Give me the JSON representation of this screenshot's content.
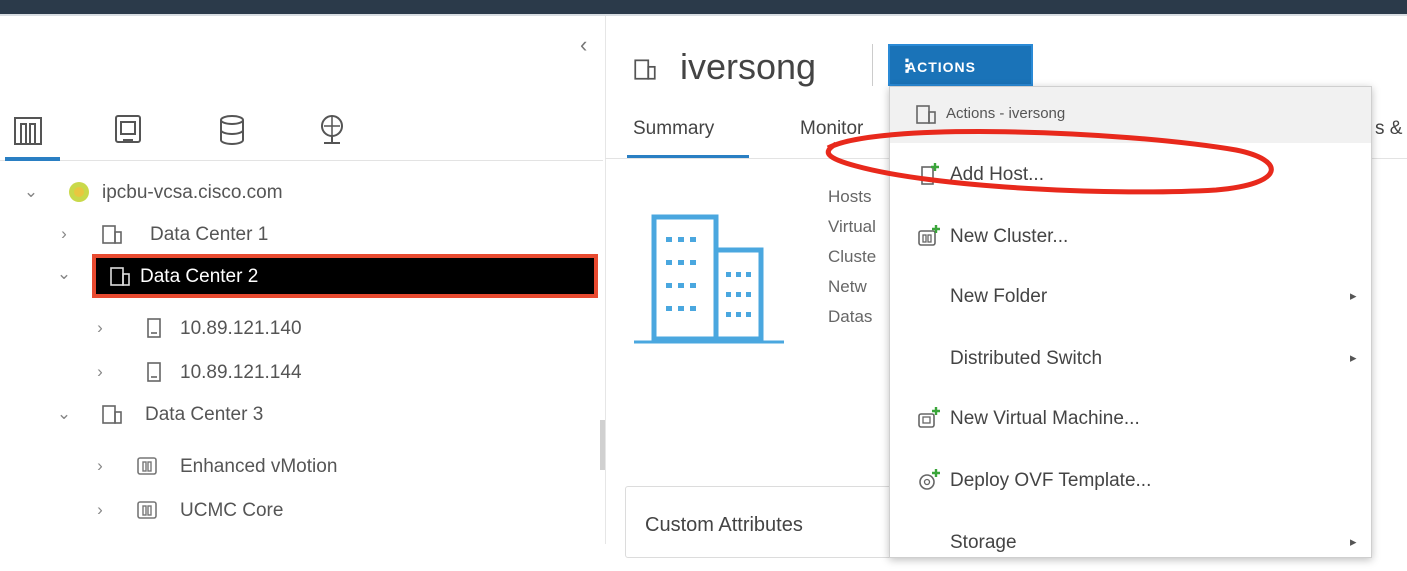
{
  "navigator": {
    "collapse_glyph": "‹",
    "tabs": [
      {
        "name": "hosts-clusters-icon"
      },
      {
        "name": "vms-templates-icon"
      },
      {
        "name": "storage-icon"
      },
      {
        "name": "networking-icon"
      }
    ],
    "tree": [
      {
        "label": "ipcbu-vcsa.cisco.com",
        "expanded": true,
        "icon": "vcenter-icon",
        "level": 0
      },
      {
        "label": "Data Center 1",
        "expanded": false,
        "icon": "datacenter-icon",
        "level": 1
      },
      {
        "label": "Data Center 2",
        "expanded": true,
        "icon": "datacenter-icon",
        "level": 1,
        "selected": true
      },
      {
        "label": "10.89.121.140",
        "expanded": false,
        "icon": "host-icon",
        "level": 2
      },
      {
        "label": "10.89.121.144",
        "expanded": false,
        "icon": "host-icon",
        "level": 2
      },
      {
        "label": "Data Center 3",
        "expanded": true,
        "icon": "datacenter-icon",
        "level": 1
      },
      {
        "label": "Enhanced vMotion",
        "expanded": false,
        "icon": "cluster-icon",
        "level": 2
      },
      {
        "label": "UCMC Core",
        "expanded": false,
        "icon": "cluster-icon",
        "level": 2
      }
    ]
  },
  "object": {
    "title": "iversong",
    "actions_label": "ACTIONS",
    "tabs": [
      {
        "label": "Summary",
        "active": true
      },
      {
        "label": "Monitor",
        "active": false
      }
    ],
    "tab_cut_right": "s &",
    "summary_labels": [
      "Hosts",
      "Virtual",
      "Cluste",
      "Netw",
      "Datas"
    ],
    "custom_attributes_title": "Custom Attributes"
  },
  "actions_menu": {
    "header": "Actions - iversong",
    "items": [
      {
        "label": "Add Host...",
        "icon": "add-host-icon",
        "submenu": false,
        "highlighted": true
      },
      {
        "label": "New Cluster...",
        "icon": "new-cluster-icon",
        "submenu": false
      },
      {
        "label": "New Folder",
        "icon": "",
        "submenu": true
      },
      {
        "label": "Distributed Switch",
        "icon": "",
        "submenu": true
      },
      {
        "label": "New Virtual Machine...",
        "icon": "new-vm-icon",
        "submenu": false
      },
      {
        "label": "Deploy OVF Template...",
        "icon": "deploy-ovf-icon",
        "submenu": false
      },
      {
        "label": "Storage",
        "icon": "",
        "submenu": true
      }
    ]
  },
  "colors": {
    "accent": "#1a73b8",
    "selection_border": "#e84a30",
    "annotation": "#e8291c",
    "topbar": "#2b3a4a"
  }
}
